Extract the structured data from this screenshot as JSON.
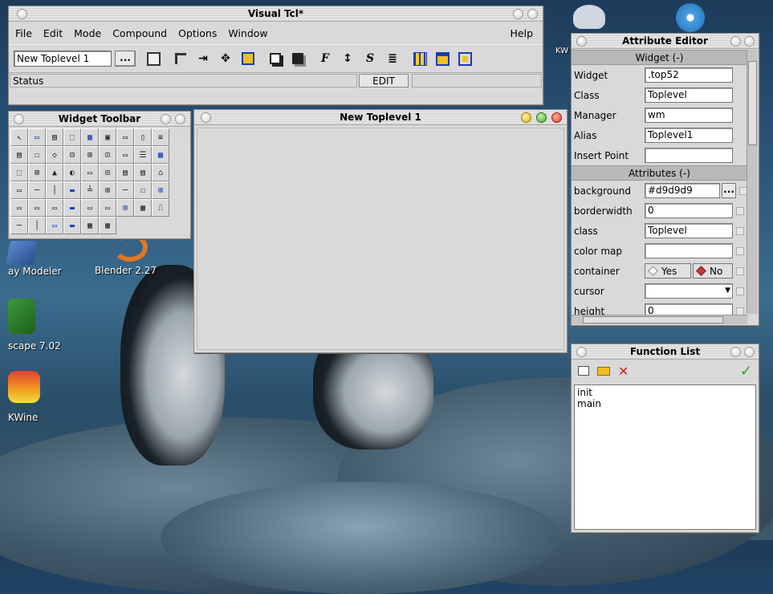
{
  "colors": {
    "window_bg": "#d9d9d9",
    "accent_blue": "#1a3bb0",
    "check_green": "#2aa02a",
    "delete_red": "#d02020"
  },
  "desktop": {
    "icons": [
      {
        "label": "ay Modeler",
        "icon": "app-icon"
      },
      {
        "label": "Blender 2.27",
        "icon": "blender-icon"
      },
      {
        "label": "scape 7.02",
        "icon": "inkscape-icon"
      },
      {
        "label": "KWine",
        "icon": "wine-icon"
      },
      {
        "label": "KW",
        "icon": "kweather-icon"
      }
    ]
  },
  "main_window": {
    "title": "Visual Tcl*",
    "menu": [
      "File",
      "Edit",
      "Mode",
      "Compound",
      "Options",
      "Window"
    ],
    "help": "Help",
    "toplevel_field": "New Toplevel 1",
    "dots": "...",
    "status": "Status",
    "mode": "EDIT",
    "tools": {
      "font_f": "F",
      "font_s": "S"
    }
  },
  "widget_toolbar": {
    "title": "Widget Toolbar"
  },
  "toplevel": {
    "title": "New Toplevel 1"
  },
  "attribute_editor": {
    "title": "Attribute Editor",
    "widget_section": "Widget (-)",
    "widget_rows": [
      {
        "label": "Widget",
        "value": ".top52"
      },
      {
        "label": "Class",
        "value": "Toplevel"
      },
      {
        "label": "Manager",
        "value": "wm"
      },
      {
        "label": "Alias",
        "value": "Toplevel1"
      },
      {
        "label": "Insert Point",
        "value": ""
      }
    ],
    "attributes_section": "Attributes (-)",
    "attribute_rows": {
      "background": {
        "label": "background",
        "value": "#d9d9d9",
        "button": "..."
      },
      "borderwidth": {
        "label": "borderwidth",
        "value": "0"
      },
      "class": {
        "label": "class",
        "value": "Toplevel"
      },
      "colormap": {
        "label": "color map",
        "value": ""
      },
      "container": {
        "label": "container",
        "yes": "Yes",
        "no": "No",
        "selected": "No"
      },
      "cursor": {
        "label": "cursor",
        "value": ""
      },
      "height": {
        "label": "height",
        "value": "0"
      }
    }
  },
  "function_list": {
    "title": "Function List",
    "items": [
      "init",
      "main"
    ]
  }
}
